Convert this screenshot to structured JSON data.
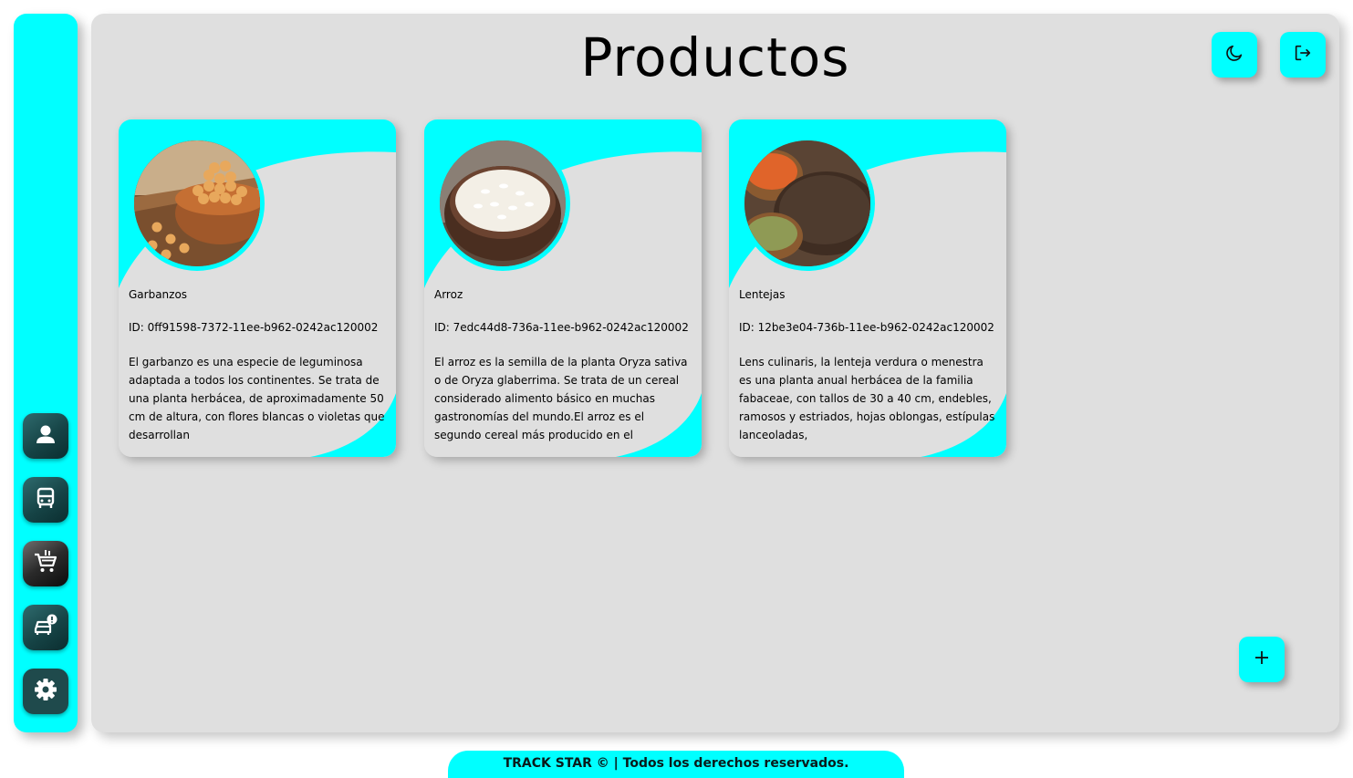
{
  "header": {
    "title": "Productos",
    "theme_toggle_icon": "moon-icon",
    "logout_icon": "logout-icon"
  },
  "sidebar": {
    "items": [
      {
        "icon": "user-icon"
      },
      {
        "icon": "truck-icon"
      },
      {
        "icon": "cart-icon"
      },
      {
        "icon": "car-alert-icon"
      },
      {
        "icon": "gear-icon"
      }
    ]
  },
  "products": [
    {
      "name": "Garbanzos",
      "id": "ID: 0ff91598-7372-11ee-b962-0242ac120002",
      "description": "El garbanzo es una especie de leguminosa adaptada a todos los continentes. Se trata de una planta herbácea, de aproximadamente 50 cm de altura, con flores blancas o violetas que desarrollan"
    },
    {
      "name": "Arroz",
      "id": "ID: 7edc44d8-736a-11ee-b962-0242ac120002",
      "description": "El arroz es la semilla de la planta Oryza sativa o de Oryza glaberrima. Se trata de un cereal considerado alimento básico en muchas gastronomías del mundo.El arroz es el segundo cereal más producido en el"
    },
    {
      "name": "Lentejas",
      "id": "ID: 12be3e04-736b-11ee-b962-0242ac120002",
      "description": "Lens culinaris, la lenteja verdura o menestra es una planta anual herbácea de la familia fabaceae, con tallos de 30 a 40 cm, endebles, ramosos y estriados, hojas oblongas, estípulas lanceoladas,"
    }
  ],
  "actions": {
    "add_icon": "plus-icon"
  },
  "footer": {
    "text": "TRACK STAR © | Todos los derechos reservados."
  },
  "colors": {
    "accent": "#00ffff",
    "panel": "#dfdfdf"
  }
}
